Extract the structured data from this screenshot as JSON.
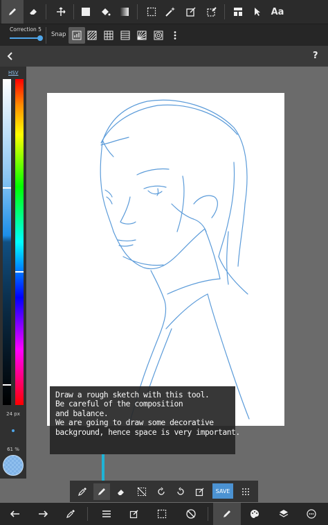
{
  "toolbar": {
    "text_tool_label": "Aa",
    "tools": [
      "brush",
      "eraser",
      "move",
      "fill-rect",
      "bucket",
      "gradient",
      "select-rect",
      "magic-wand",
      "transform",
      "select-pen",
      "layer-view",
      "select-arrow",
      "text"
    ]
  },
  "options": {
    "correction_label": "Correction 5",
    "correction_level": 0.5,
    "snap_label": "Snap"
  },
  "color_panel": {
    "mode_label": "HSV",
    "brush_size": "24 px",
    "opacity": "61 %",
    "current_color": "#8fbfee",
    "accent_color": "#4b92d2"
  },
  "tooltip": {
    "lines": [
      "Draw a rough sketch with this tool.",
      "Be careful of the composition",
      "and balance.",
      "We are going to draw some decorative",
      "background, hence space is very important."
    ]
  },
  "sub_toolbar": {
    "save_label": "SAVE"
  }
}
